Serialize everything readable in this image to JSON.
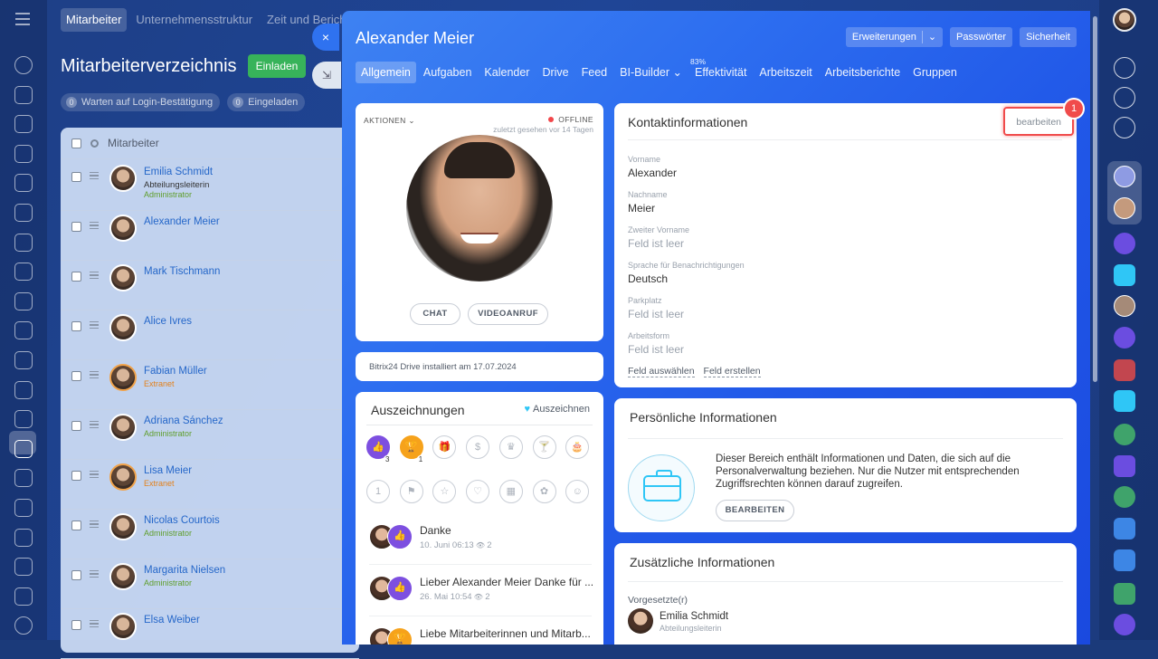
{
  "background": {
    "top_tabs": [
      "Mitarbeiter",
      "Unternehmensstruktur",
      "Zeit und Berichte"
    ],
    "page_title": "Mitarbeiterverzeichnis",
    "invite_button": "Einladen",
    "filters": [
      {
        "count": "0",
        "label": "Warten auf Login-Bestätigung"
      },
      {
        "count": "0",
        "label": "Eingeladen"
      }
    ],
    "list_header": "Mitarbeiter",
    "employees": [
      {
        "name": "Emilia Schmidt",
        "position": "Abteilungsleiterin",
        "role": "Administrator",
        "extranet": false
      },
      {
        "name": "Alexander Meier",
        "position": "",
        "role": "",
        "extranet": false
      },
      {
        "name": "Mark Tischmann",
        "position": "",
        "role": "",
        "extranet": false
      },
      {
        "name": "Alice Ivres",
        "position": "",
        "role": "",
        "extranet": false
      },
      {
        "name": "Fabian Müller",
        "position": "",
        "role": "Extranet",
        "extranet": true
      },
      {
        "name": "Adriana Sánchez",
        "position": "",
        "role": "Administrator",
        "extranet": false
      },
      {
        "name": "Lisa Meier",
        "position": "",
        "role": "Extranet",
        "extranet": true
      },
      {
        "name": "Nicolas Courtois",
        "position": "",
        "role": "Administrator",
        "extranet": false
      },
      {
        "name": "Margarita Nielsen",
        "position": "",
        "role": "Administrator",
        "extranet": false
      },
      {
        "name": "Elsa Weiber",
        "position": "",
        "role": "",
        "extranet": false
      }
    ]
  },
  "slider": {
    "close_icon": "×",
    "minimize_icon": "⇲"
  },
  "profile": {
    "name": "Alexander Meier",
    "header_buttons": {
      "extensions": "Erweiterungen",
      "passwords": "Passwörter",
      "security": "Sicherheit"
    },
    "tabs": [
      {
        "label": "Allgemein",
        "selected": true
      },
      {
        "label": "Aufgaben"
      },
      {
        "label": "Kalender"
      },
      {
        "label": "Drive"
      },
      {
        "label": "Feed"
      },
      {
        "label": "BI-Builder ⌄"
      },
      {
        "label": "Effektivität",
        "badge": "83%"
      },
      {
        "label": "Arbeitszeit"
      },
      {
        "label": "Arbeitsberichte"
      },
      {
        "label": "Gruppen"
      }
    ],
    "avatar_card": {
      "actions": "AKTIONEN ⌄",
      "status": "OFFLINE",
      "last_seen": "zuletzt gesehen vor 14 Tagen",
      "chat_button": "CHAT",
      "video_button": "VIDEOANRUF"
    },
    "drive_info": "Bitrix24 Drive installiert am 17.07.2024",
    "awards": {
      "title": "Auszeichnungen",
      "action": "Auszeichnen",
      "badge_counts": [
        "3",
        "1"
      ],
      "thanks": [
        {
          "title": "Danke",
          "date": "10. Juni 06:13",
          "views": "2"
        },
        {
          "title": "Lieber Alexander Meier Danke für ...",
          "date": "26. Mai 10:54",
          "views": "2"
        },
        {
          "title": "Liebe Mitarbeiterinnen und Mitarb...",
          "date": "",
          "views": ""
        }
      ]
    },
    "contact": {
      "title": "Kontaktinformationen",
      "edit": "bearbeiten",
      "marker": "1",
      "fields": [
        {
          "label": "Vorname",
          "value": "Alexander",
          "empty": false
        },
        {
          "label": "Nachname",
          "value": "Meier",
          "empty": false
        },
        {
          "label": "Zweiter Vorname",
          "value": "Feld ist leer",
          "empty": true
        },
        {
          "label": "Sprache für Benachrichtigungen",
          "value": "Deutsch",
          "empty": false
        },
        {
          "label": "Parkplatz",
          "value": "Feld ist leer",
          "empty": true
        },
        {
          "label": "Arbeitsform",
          "value": "Feld ist leer",
          "empty": true
        }
      ],
      "select_field": "Feld auswählen",
      "create_field": "Feld erstellen"
    },
    "personal": {
      "title": "Persönliche Informationen",
      "text": "Dieser Bereich enthält Informationen und Daten, die sich auf die Personalverwaltung beziehen. Nur die Nutzer mit entsprechenden Zugriffsrechten können darauf zugreifen.",
      "button": "BEARBEITEN"
    },
    "extra": {
      "title": "Zusätzliche Informationen",
      "supervisor_label": "Vorgesetzte(r)",
      "supervisor_name": "Emilia Schmidt",
      "supervisor_position": "Abteilungsleiterin"
    }
  },
  "colors": {
    "accent": "#2f72f0",
    "highlight": "#f04b4b",
    "online_green": "#37b35a",
    "offline_red": "#f2464a"
  }
}
